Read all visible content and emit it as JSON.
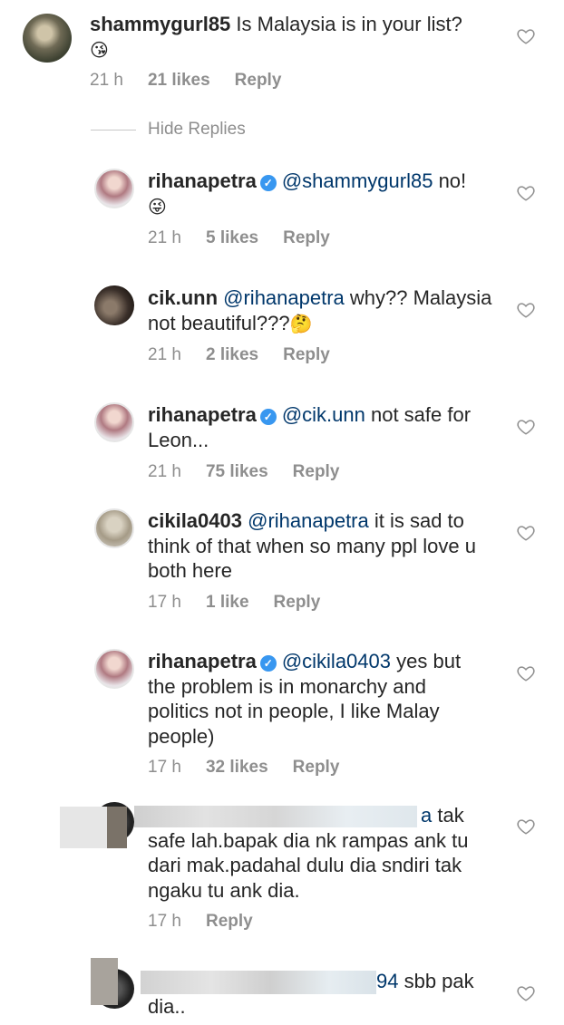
{
  "comments": [
    {
      "user": "shammygurl85",
      "text": " Is Malaysia is in your list?",
      "emoji": "😘",
      "time": "21 h",
      "likes": "21 likes",
      "reply": "Reply"
    }
  ],
  "hide_replies": "Hide Replies",
  "replies": [
    {
      "user": "rihanapetra",
      "verified": true,
      "mention": "@shammygurl85",
      "text": " no!",
      "emoji": "😜",
      "time": "21 h",
      "likes": "5 likes",
      "reply": "Reply"
    },
    {
      "user": "cik.unn",
      "mention": "@rihanapetra",
      "text_line1": " why?? Malaysia",
      "text_line2": "not beautiful???",
      "emoji": "🤔",
      "time": "21 h",
      "likes": "2 likes",
      "reply": "Reply"
    },
    {
      "user": "rihanapetra",
      "verified": true,
      "mention": "@cik.unn",
      "text_line1": " not safe for",
      "text_line2": "Leon...",
      "time": "21 h",
      "likes": "75 likes",
      "reply": "Reply"
    },
    {
      "user": "cikila0403",
      "mention": "@rihanapetra",
      "text_line1": " it is sad to",
      "text_line2": "think of that when so many ppl love u",
      "text_line3": "both here",
      "time": "17 h",
      "likes": "1 like",
      "reply": "Reply"
    },
    {
      "user": "rihanapetra",
      "verified": true,
      "mention": "@cikila0403",
      "text_line1": " yes but",
      "text_line2": "the problem is in monarchy and",
      "text_line3": "politics not in people, I like Malay",
      "text_line4": "people)",
      "time": "17 h",
      "likes": "32 likes",
      "reply": "Reply"
    },
    {
      "mention_tail": "a",
      "text_line1": " tak",
      "text_line2": "safe lah.bapak dia nk rampas ank tu",
      "text_line3": "dari mak.padahal dulu dia sndiri tak",
      "text_line4": "ngaku tu ank dia.",
      "time": "17 h",
      "reply": "Reply"
    },
    {
      "mention_tail": "94",
      "text_line1": " sbb pak",
      "text_line2": "dia.."
    }
  ]
}
